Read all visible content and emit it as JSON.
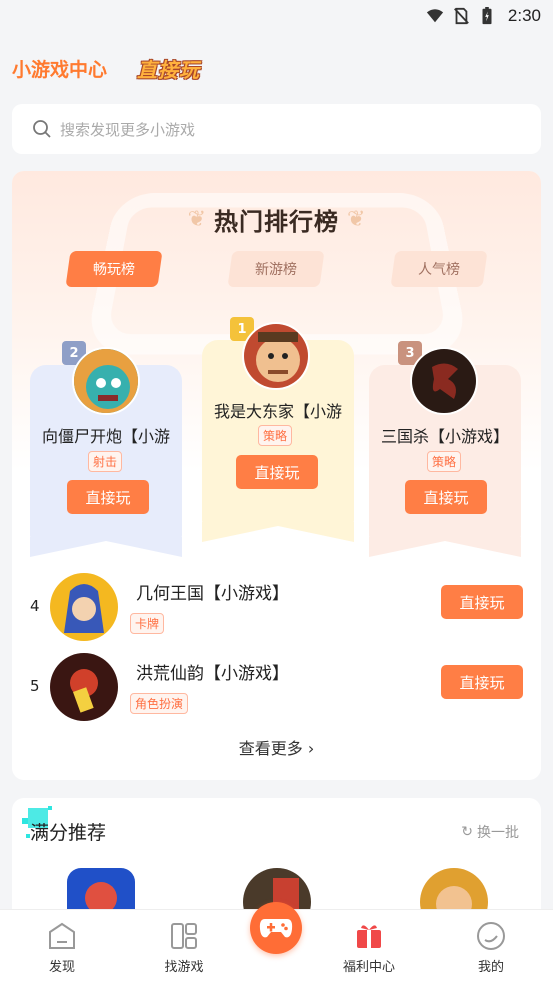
{
  "status_bar": {
    "time": "2:30"
  },
  "header": {
    "title": "小游戏中心",
    "logo_text": "直接玩"
  },
  "search": {
    "placeholder": "搜索发现更多小游戏"
  },
  "ranking": {
    "title": "热门排行榜",
    "tabs": [
      {
        "label": "畅玩榜",
        "active": true
      },
      {
        "label": "新游榜",
        "active": false
      },
      {
        "label": "人气榜",
        "active": false
      }
    ],
    "top3": [
      {
        "rank": "1",
        "name": "我是大东家【小游",
        "tag": "策略",
        "button": "直接玩"
      },
      {
        "rank": "2",
        "name": "向僵尸开炮【小游",
        "tag": "射击",
        "button": "直接玩"
      },
      {
        "rank": "3",
        "name": "三国杀【小游戏】",
        "tag": "策略",
        "button": "直接玩"
      }
    ],
    "list": [
      {
        "rank": "4",
        "name": "几何王国【小游戏】",
        "tag": "卡牌",
        "button": "直接玩"
      },
      {
        "rank": "5",
        "name": "洪荒仙韵【小游戏】",
        "tag": "角色扮演",
        "button": "直接玩"
      }
    ],
    "see_more": "查看更多"
  },
  "recommend": {
    "title": "满分推荐",
    "refresh": "换一批"
  },
  "bottom_nav": [
    {
      "label": "发现",
      "icon": "home-icon"
    },
    {
      "label": "找游戏",
      "icon": "grid-icon"
    },
    {
      "label": "",
      "icon": "gamepad-icon"
    },
    {
      "label": "福利中心",
      "icon": "gift-icon"
    },
    {
      "label": "我的",
      "icon": "profile-icon"
    }
  ],
  "colors": {
    "accent": "#ff7e45",
    "title_orange": "#ff7a2f",
    "rank1": "#f4c23a",
    "rank2": "#8f9fc7",
    "rank3": "#c9927e"
  }
}
